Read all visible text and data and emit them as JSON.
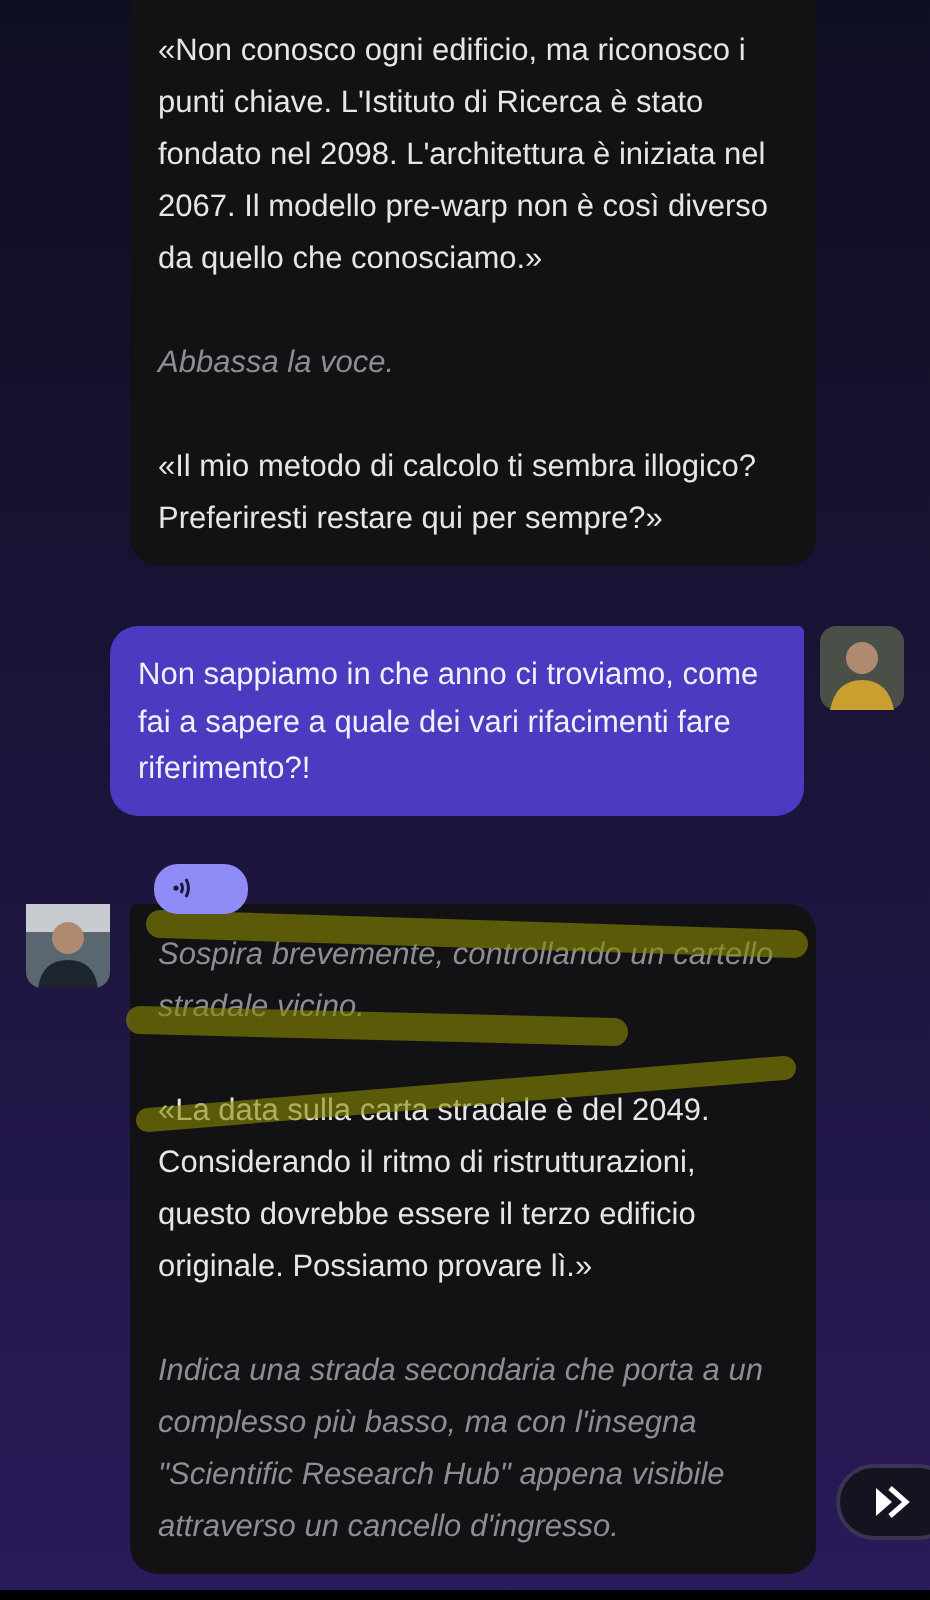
{
  "messages": [
    {
      "kind": "bot",
      "show_avatar": false,
      "has_audio": false,
      "paragraphs": [
        {
          "kind": "speech",
          "text": "«Non conosco ogni edificio, ma riconosco i punti chiave. L'Istituto di Ricerca è stato fondato nel 2098. L'architettura è iniziata nel 2067. Il modello pre-warp non è così diverso da quello che conosciamo.»"
        },
        {
          "kind": "action",
          "text": "Abbassa la voce."
        },
        {
          "kind": "speech",
          "text": "«Il mio metodo di calcolo ti sembra illogico? Preferiresti restare qui per sempre?»"
        }
      ]
    },
    {
      "kind": "user",
      "show_avatar": true,
      "has_audio": false,
      "paragraphs": [
        {
          "kind": "speech",
          "text": "Non sappiamo in che anno ci troviamo, come fai a sapere a quale dei vari rifacimenti fare riferimento?!"
        }
      ]
    },
    {
      "kind": "bot",
      "show_avatar": true,
      "has_audio": true,
      "paragraphs": [
        {
          "kind": "action",
          "text": "Sospira brevemente, controllando un cartello stradale vicino."
        },
        {
          "kind": "speech",
          "text": "«La data sulla carta stradale è del 2049. Considerando il ritmo di ristrutturazioni, questo dovrebbe essere il terzo edificio originale. Possiamo provare lì.»"
        },
        {
          "kind": "action",
          "text": "Indica una strada secondaria che porta a un complesso più basso, ma con l'insegna \"Scientific Research Hub\" appena visibile attraverso un cancello d'ingresso."
        }
      ]
    }
  ]
}
